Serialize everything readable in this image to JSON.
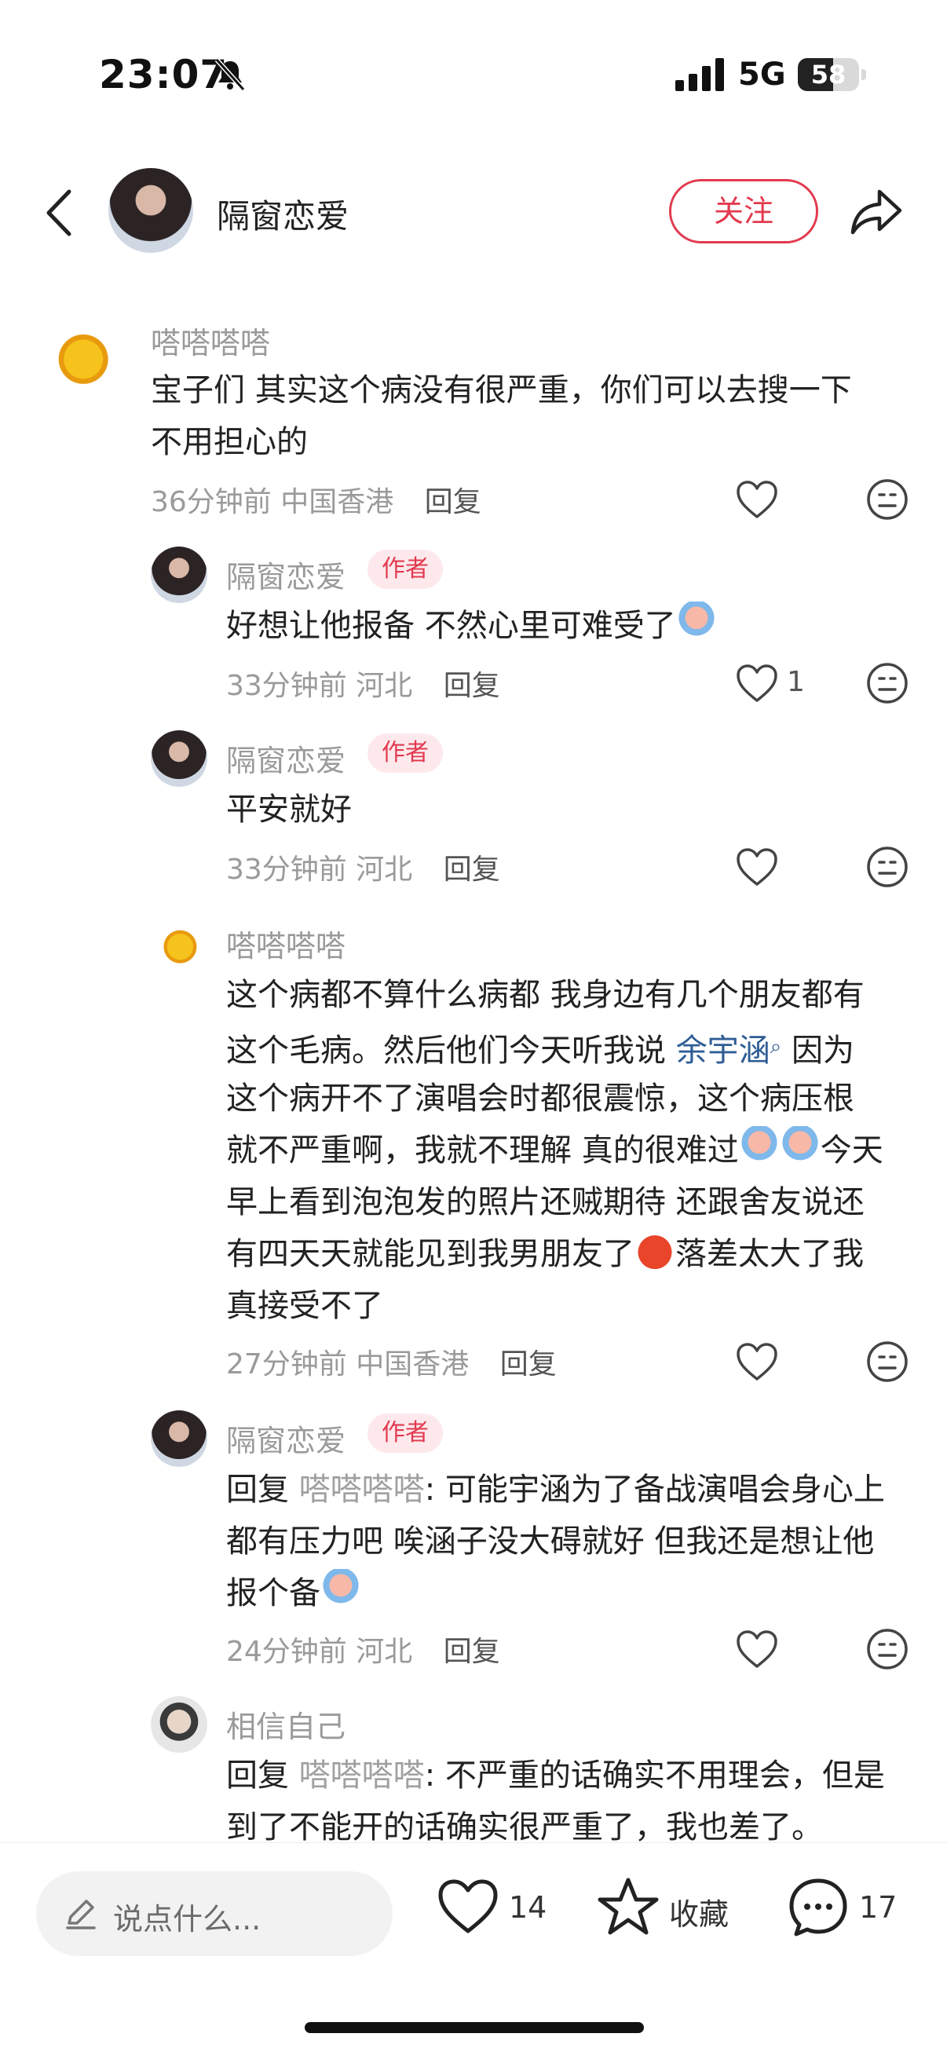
{
  "status": {
    "time": "23:07",
    "network": "5G",
    "battery": "58",
    "battery_level": 0.58
  },
  "nav": {
    "title": "隔窗恋爱",
    "follow_label": "关注"
  },
  "comments": [
    {
      "user": "嗒嗒嗒嗒",
      "text_lines": [
        "宝子们 其实这个病没有很严重，你们可以去搜一下",
        "不用担心的"
      ],
      "time": "36分钟前",
      "location": "中国香港",
      "reply_label": "回复"
    },
    {
      "user": "隔窗恋爱",
      "tag": "作者",
      "text": "好想让他报备 不然心里可难受了",
      "time": "33分钟前",
      "location": "河北",
      "reply_label": "回复",
      "likes": "1"
    },
    {
      "user": "隔窗恋爱",
      "tag": "作者",
      "text": "平安就好",
      "time": "33分钟前",
      "location": "河北",
      "reply_label": "回复"
    },
    {
      "user": "嗒嗒嗒嗒",
      "line1": "这个病都不算什么病都 我身边有几个朋友都有",
      "line2a": "这个毛病。然后他们今天听我说 ",
      "line2link": "余宇涵",
      "line2b": " 因为",
      "line3": "这个病开不了演唱会时都很震惊，这个病压根",
      "line4a": "就不严重啊，我就不理解 真的很难过",
      "line4b": "今天",
      "line5": "早上看到泡泡发的照片还贼期待 还跟舍友说还",
      "line6a": "有四天天就能见到我男朋友了",
      "line6b": "落差太大了我",
      "line7": "真接受不了",
      "time": "27分钟前",
      "location": "中国香港",
      "reply_label": "回复"
    },
    {
      "user": "隔窗恋爱",
      "tag": "作者",
      "reply_prefix": "回复 ",
      "reply_to": "嗒嗒嗒嗒",
      "line1": ": 可能宇涵为了备战演唱会身心上",
      "line2": "都有压力吧 唉涵子没大碍就好 但我还是想让他",
      "line3": "报个备",
      "time": "24分钟前",
      "location": "河北",
      "reply_label": "回复"
    },
    {
      "user": "相信自己",
      "reply_prefix": "回复 ",
      "reply_to": "嗒嗒嗒嗒",
      "line1": ": 不严重的话确实不用理会，但是",
      "line2": "到了不能开的话确实很严重了，我也差了。"
    }
  ],
  "bottom": {
    "placeholder": "说点什么...",
    "likes": "14",
    "collect_label": "收藏",
    "comments": "17"
  },
  "colors": {
    "accent": "#e23a4f",
    "link": "#2f5d95"
  },
  "icons": [
    "bell-muted-icon",
    "signal-icon",
    "battery-icon",
    "back-icon",
    "share-icon",
    "heart-icon",
    "face-icon",
    "pencil-icon",
    "star-icon",
    "comment-icon"
  ]
}
